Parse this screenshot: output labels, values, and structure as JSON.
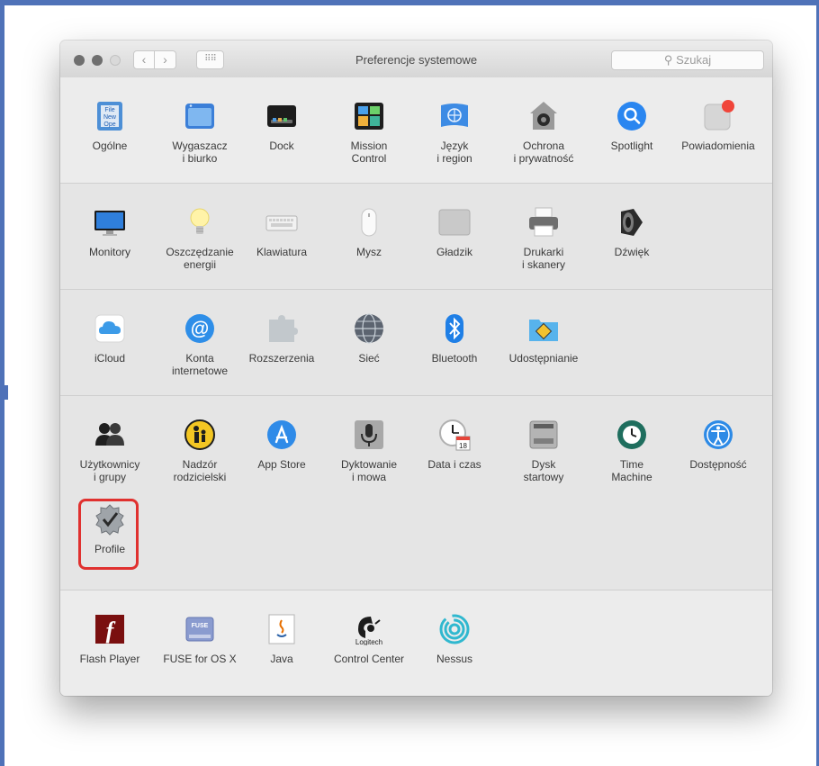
{
  "window": {
    "title": "Preferencje systemowe",
    "search_placeholder": "Szukaj",
    "back_glyph": "‹",
    "forward_glyph": "›",
    "grid_glyph": "⠿⠿"
  },
  "sections": [
    {
      "items": [
        {
          "label": "Ogólne",
          "icon": "general-icon"
        },
        {
          "label": "Wygaszacz\ni biurko",
          "icon": "desktop-screensaver-icon"
        },
        {
          "label": "Dock",
          "icon": "dock-icon"
        },
        {
          "label": "Mission\nControl",
          "icon": "mission-control-icon"
        },
        {
          "label": "Język\ni region",
          "icon": "language-region-icon"
        },
        {
          "label": "Ochrona\ni prywatność",
          "icon": "security-privacy-icon"
        },
        {
          "label": "Spotlight",
          "icon": "spotlight-icon"
        },
        {
          "label": "Powiadomienia",
          "icon": "notifications-icon"
        }
      ]
    },
    {
      "items": [
        {
          "label": "Monitory",
          "icon": "displays-icon"
        },
        {
          "label": "Oszczędzanie\nenergii",
          "icon": "energy-saver-icon"
        },
        {
          "label": "Klawiatura",
          "icon": "keyboard-icon"
        },
        {
          "label": "Mysz",
          "icon": "mouse-icon"
        },
        {
          "label": "Gładzik",
          "icon": "trackpad-icon"
        },
        {
          "label": "Drukarki\ni skanery",
          "icon": "printers-scanners-icon"
        },
        {
          "label": "Dźwięk",
          "icon": "sound-icon"
        }
      ]
    },
    {
      "items": [
        {
          "label": "iCloud",
          "icon": "icloud-icon"
        },
        {
          "label": "Konta\ninternetowe",
          "icon": "internet-accounts-icon"
        },
        {
          "label": "Rozszerzenia",
          "icon": "extensions-icon"
        },
        {
          "label": "Sieć",
          "icon": "network-icon"
        },
        {
          "label": "Bluetooth",
          "icon": "bluetooth-icon"
        },
        {
          "label": "Udostępnianie",
          "icon": "sharing-icon"
        }
      ]
    },
    {
      "items": [
        {
          "label": "Użytkownicy\ni grupy",
          "icon": "users-groups-icon"
        },
        {
          "label": "Nadzór\nrodzicielski",
          "icon": "parental-controls-icon"
        },
        {
          "label": "App Store",
          "icon": "app-store-icon"
        },
        {
          "label": "Dyktowanie\ni mowa",
          "icon": "dictation-speech-icon"
        },
        {
          "label": "Data i czas",
          "icon": "date-time-icon"
        },
        {
          "label": "Dysk\nstartowy",
          "icon": "startup-disk-icon"
        },
        {
          "label": "Time\nMachine",
          "icon": "time-machine-icon"
        },
        {
          "label": "Dostępność",
          "icon": "accessibility-icon"
        },
        {
          "label": "Profile",
          "icon": "profiles-icon"
        }
      ]
    },
    {
      "items": [
        {
          "label": "Flash Player",
          "icon": "flash-player-icon"
        },
        {
          "label": "FUSE for OS X",
          "icon": "fuse-icon"
        },
        {
          "label": "Java",
          "icon": "java-icon"
        },
        {
          "label": "Control Center",
          "icon": "logitech-control-center-icon"
        },
        {
          "label": "Nessus",
          "icon": "nessus-icon"
        }
      ]
    }
  ],
  "icon_text": {
    "general_lines": [
      "File",
      "New",
      "Ope"
    ],
    "date_day": "18",
    "fuse_text": "FUSE",
    "logitech_text": "Logitech",
    "flash_glyph": "f",
    "bluetooth_glyph": "ᛒ",
    "at_glyph": "@"
  },
  "colors": {
    "highlight": "#e0312f",
    "frame": "#4f72b8"
  }
}
